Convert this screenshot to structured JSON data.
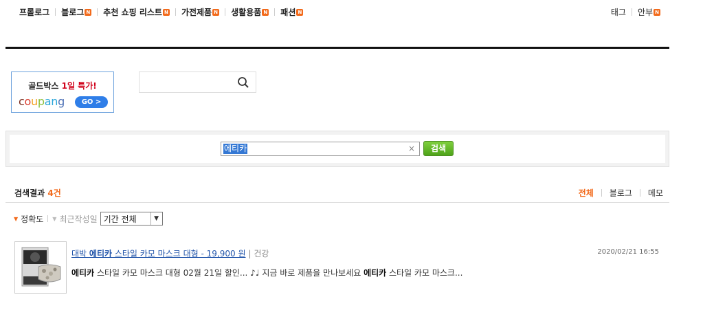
{
  "topnav": {
    "items": [
      {
        "label": "프롤로그",
        "badge": ""
      },
      {
        "label": "블로그",
        "badge": "N"
      },
      {
        "label": "추천 쇼핑 리스트",
        "badge": "N"
      },
      {
        "label": "가전제품",
        "badge": "N"
      },
      {
        "label": "생활용품",
        "badge": "N"
      },
      {
        "label": "패션",
        "badge": "N"
      }
    ],
    "right": [
      {
        "label": "태그",
        "badge": ""
      },
      {
        "label": "안부",
        "badge": "N"
      }
    ]
  },
  "banner": {
    "title_prefix": "골드박스 ",
    "title_red": "1일 특가!",
    "logo": "coupang",
    "go_label": "GO >"
  },
  "mini_search": {
    "placeholder": "",
    "icon": "search-icon"
  },
  "search": {
    "query": "에티카",
    "clear": "×",
    "button_label": "검색"
  },
  "results": {
    "title": "검색결과",
    "count": "4건",
    "tabs": [
      "전체",
      "블로그",
      "메모"
    ],
    "active_tab": "전체"
  },
  "sort": {
    "accuracy": "정확도",
    "recent": "최근작성일",
    "period_selected": "기간 전체"
  },
  "items": [
    {
      "title_pre": "대박 ",
      "title_bold": "에티카",
      "title_post": " 스타일 카모 마스크 대형 - 19,900 원",
      "category": "| 건강",
      "date": "2020/02/21 16:55",
      "desc_1": "에티카",
      "desc_2": " 스타일 카모 마스크 대형 02월 21일 할인... ♪♩ 지금 바로 제품을 만나보세요 ",
      "desc_3": "에티카",
      "desc_4": " 스타일 카모 마스크..."
    }
  ],
  "colors": {
    "accent": "#f26a1b",
    "link": "#2255aa",
    "search_btn": "#5aa823",
    "selection": "#3478d4"
  }
}
